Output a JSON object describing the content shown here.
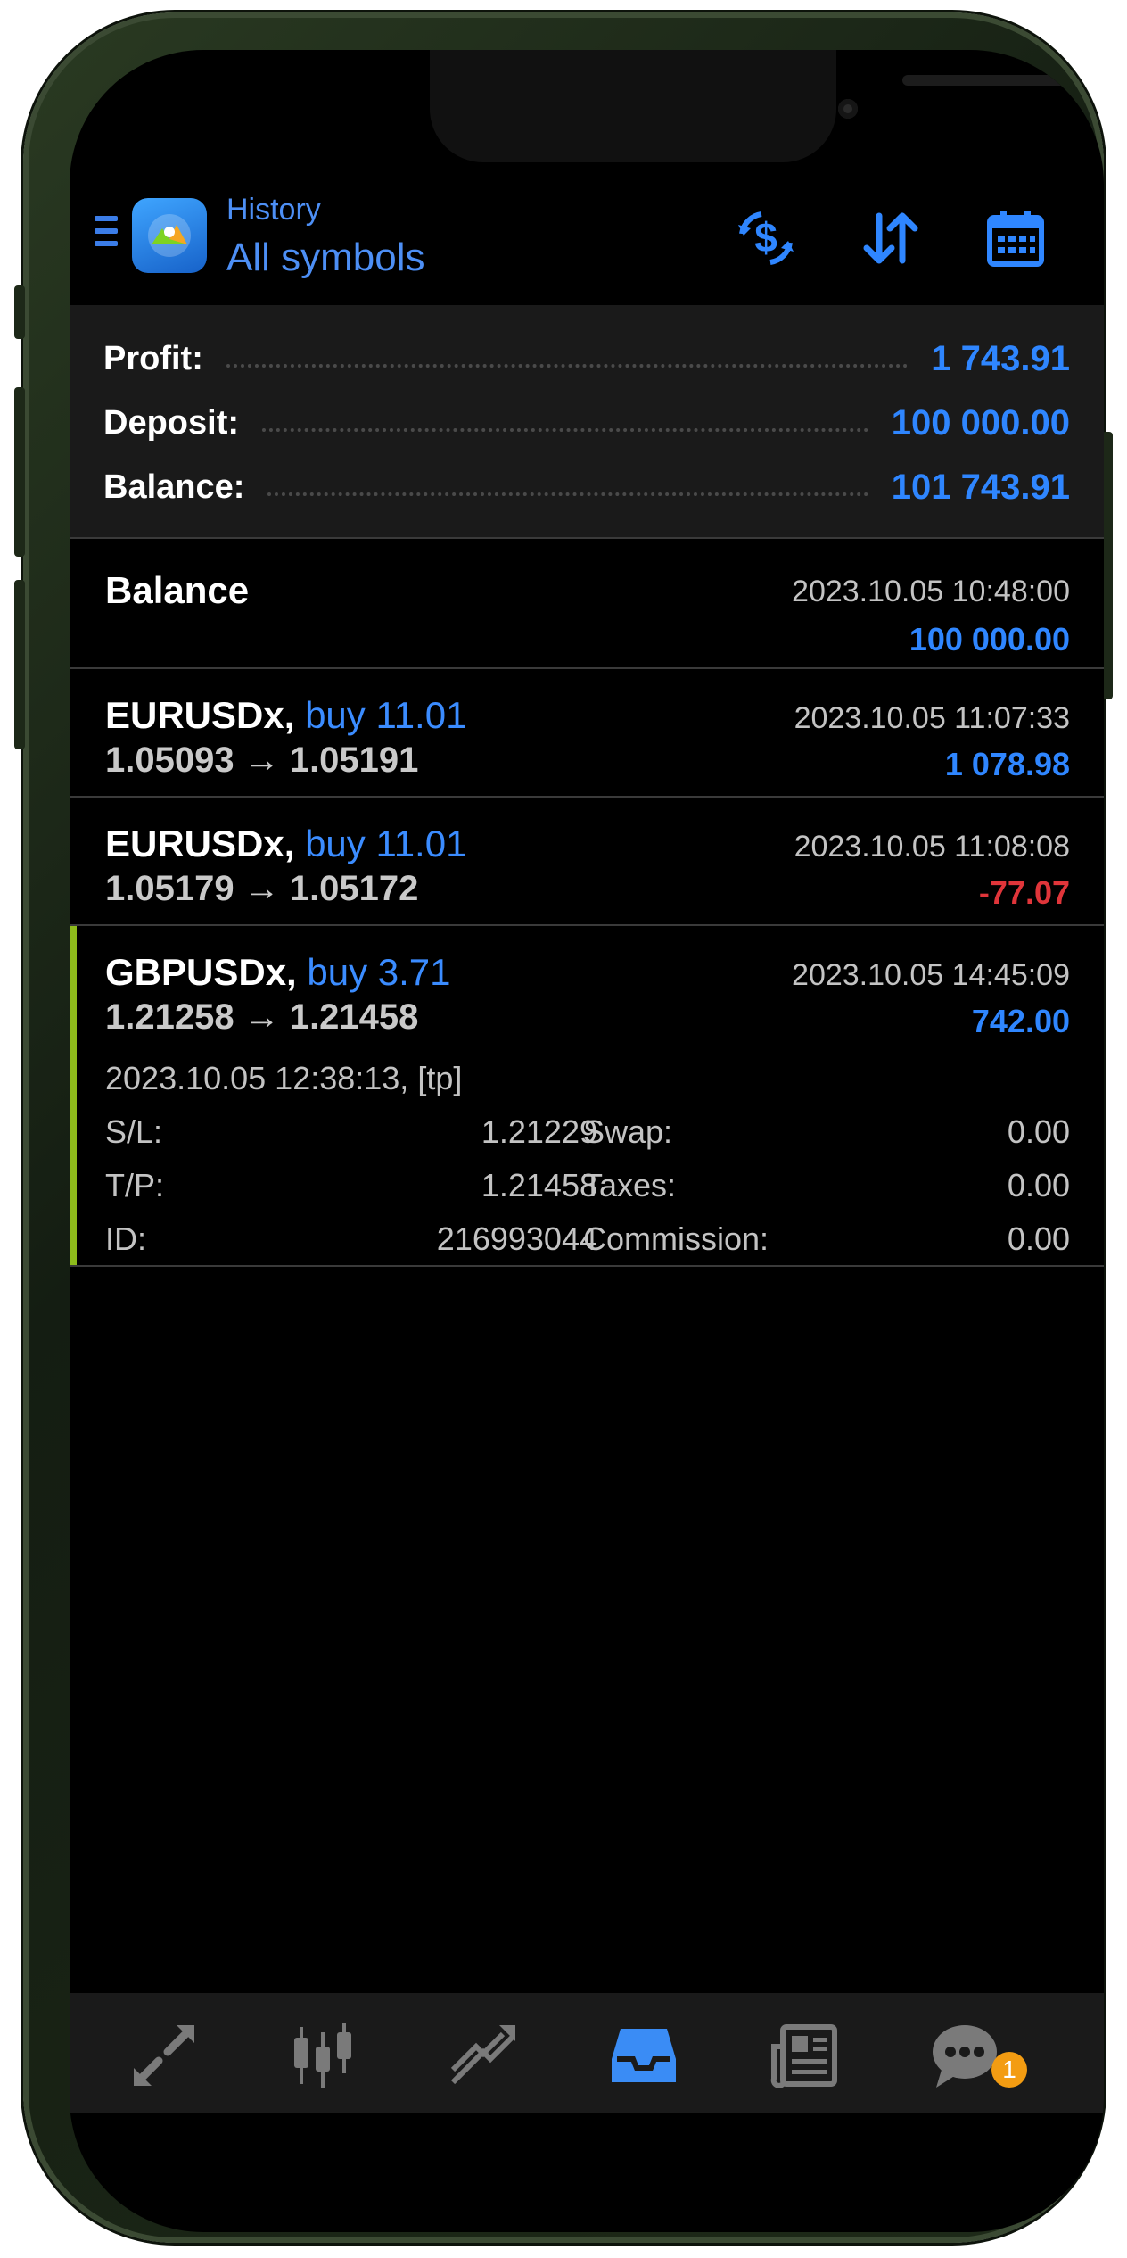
{
  "header": {
    "subtitle": "History",
    "title": "All symbols"
  },
  "summary": {
    "profit_label": "Profit:",
    "profit_value": "1 743.91",
    "deposit_label": "Deposit:",
    "deposit_value": "100 000.00",
    "balance_label": "Balance:",
    "balance_value": "101 743.91"
  },
  "balance_entry": {
    "label": "Balance",
    "time": "2023.10.05 10:48:00",
    "amount": "100 000.00"
  },
  "deals": [
    {
      "symbol": "EURUSDx,",
      "side": "buy 11.01",
      "prices": "1.05093 → 1.05191",
      "time": "2023.10.05 11:07:33",
      "profit": "1 078.98"
    },
    {
      "symbol": "EURUSDx,",
      "side": "buy 11.01",
      "prices": "1.05179 → 1.05172",
      "time": "2023.10.05 11:08:08",
      "profit": "-77.07"
    },
    {
      "symbol": "GBPUSDx,",
      "side": "buy 3.71",
      "prices": "1.21258 → 1.21458",
      "time": "2023.10.05 14:45:09",
      "profit": "742.00",
      "open_info": "2023.10.05 12:38:13, [tp]",
      "sl_label": "S/L:",
      "sl_value": "1.21229",
      "tp_label": "T/P:",
      "tp_value": "1.21458",
      "id_label": "ID:",
      "id_value": "216993044",
      "swap_label": "Swap:",
      "swap_value": "0.00",
      "taxes_label": "Taxes:",
      "taxes_value": "0.00",
      "commission_label": "Commission:",
      "commission_value": "0.00"
    }
  ],
  "nav": {
    "icons": [
      "quotes-icon",
      "chart-icon",
      "trade-icon",
      "history-icon",
      "news-icon",
      "chat-icon"
    ],
    "active": "history-icon",
    "chat_badge": "1"
  },
  "colors": {
    "accent": "#2f86ff",
    "negative": "#e0353a",
    "selection": "#8dbb1b"
  }
}
